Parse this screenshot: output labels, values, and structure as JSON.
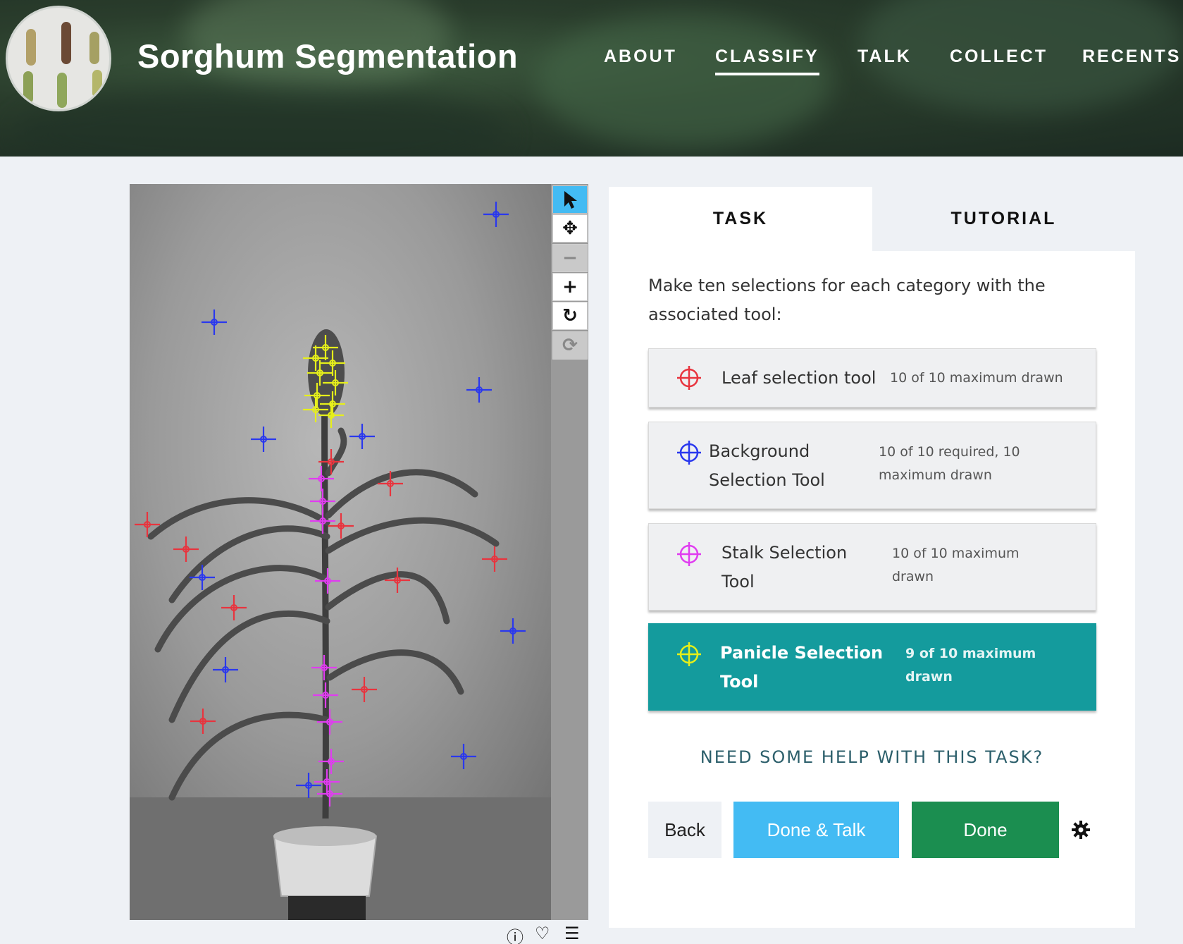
{
  "project": {
    "title": "Sorghum Segmentation"
  },
  "nav": [
    {
      "label": "ABOUT"
    },
    {
      "label": "CLASSIFY"
    },
    {
      "label": "TALK"
    },
    {
      "label": "COLLECT"
    },
    {
      "label": "RECENTS"
    }
  ],
  "active_nav": "CLASSIFY",
  "tabs": {
    "task": "TASK",
    "tutorial": "TUTORIAL"
  },
  "task": {
    "instruction": "Make ten selections for each category with the associated tool:",
    "tools": [
      {
        "name": "Leaf selection tool",
        "count": "10 of 10 maximum drawn",
        "color": "#e8343e",
        "active": false
      },
      {
        "name": "Background Selection Tool",
        "count": "10 of 10 required, 10 maximum drawn",
        "color": "#2a38ee",
        "active": false
      },
      {
        "name": "Stalk Selection Tool",
        "count": "10 of 10 maximum drawn",
        "color": "#e03cf0",
        "active": false
      },
      {
        "name": "Panicle Selection Tool",
        "count": "9 of 10 maximum drawn",
        "color": "#e6ef1a",
        "active": true
      }
    ],
    "help": "NEED SOME HELP WITH THIS TASK?"
  },
  "buttons": {
    "back": "Back",
    "done_talk": "Done & Talk",
    "done": "Done"
  },
  "viewer_tools": [
    "pointer-icon",
    "move-icon",
    "zoom-out-icon",
    "zoom-in-icon",
    "rotate-icon",
    "reset-icon"
  ],
  "subject_meta_icons": [
    "info-icon",
    "favorite-icon",
    "collections-icon"
  ],
  "colors": {
    "leaf": "#e8343e",
    "background": "#2a38ee",
    "stalk": "#e03cf0",
    "panicle": "#e6ef1a",
    "active_tool": "#149b9d",
    "done_talk": "#43bbf3",
    "done": "#1b8e50"
  }
}
